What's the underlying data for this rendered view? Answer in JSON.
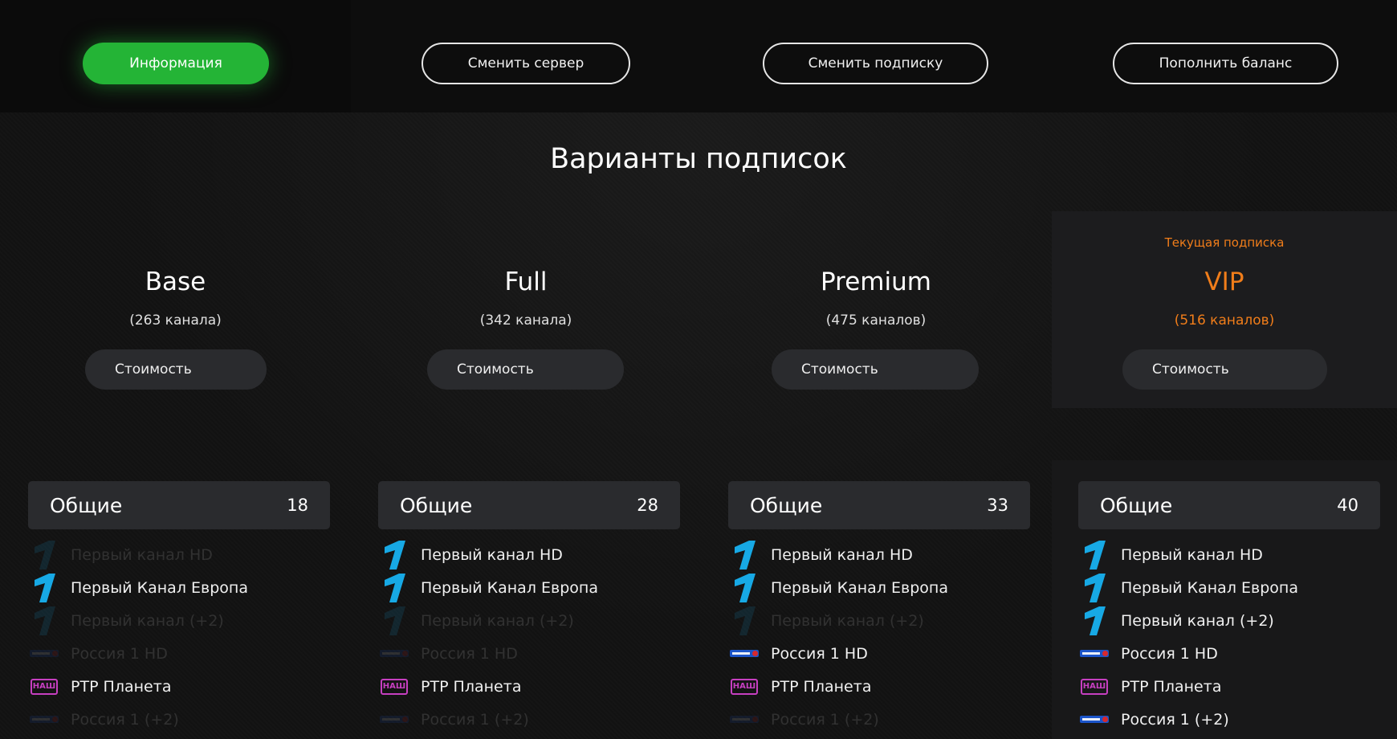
{
  "nav": {
    "info": "Информация",
    "change_server": "Сменить сервер",
    "change_subscription": "Сменить подписку",
    "top_up": "Пополнить баланс"
  },
  "page_title": "Варианты подписок",
  "current_label": "Текущая подписка",
  "price_label": "Стоимость",
  "plans": [
    {
      "name": "Base",
      "count": "(263 канала)"
    },
    {
      "name": "Full",
      "count": "(342 канала)"
    },
    {
      "name": "Premium",
      "count": "(475 каналов)"
    },
    {
      "name": "VIP",
      "count": "(516 каналов)"
    }
  ],
  "colors": {
    "accent_green": "#24b436",
    "current_orange": "#f07d1a"
  },
  "category": {
    "name": "Общие",
    "counts": [
      "18",
      "28",
      "33",
      "40"
    ]
  },
  "channels": [
    {
      "name": "Первый канал HD",
      "logo": "perviy-kanal-logo"
    },
    {
      "name": "Первый Канал Европа",
      "logo": "perviy-kanal-logo"
    },
    {
      "name": "Первый канал (+2)",
      "logo": "perviy-kanal-logo"
    },
    {
      "name": "Россия 1 HD",
      "logo": "russia-logo"
    },
    {
      "name": "РТР Планета",
      "logo": "nash-logo"
    },
    {
      "name": "Россия 1 (+2)",
      "logo": "russia-logo"
    }
  ],
  "logo_text": {
    "nash": "НАШ"
  }
}
